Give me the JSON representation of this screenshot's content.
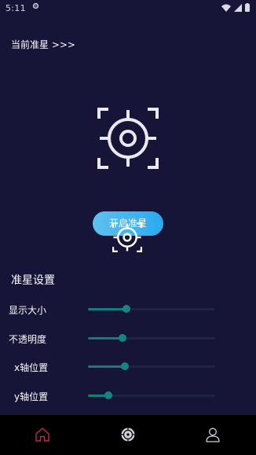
{
  "status_bar": {
    "time": "5:11",
    "left_icon": "settings-gear-icon",
    "right_icons": [
      "wifi-icon",
      "cellular-signal-icon",
      "battery-icon"
    ]
  },
  "header": {
    "current_crosshair_label": "当前准星 >>>"
  },
  "preview": {
    "icon": "crosshair-icon"
  },
  "start_button": {
    "label": "开启准星",
    "gradient": [
      "#5fc0ef",
      "#2aaaf0"
    ]
  },
  "settings": {
    "title": "准星设置",
    "sliders": [
      {
        "label": "显示大小",
        "value": 0.3
      },
      {
        "label": "不透明度",
        "value": 0.27
      },
      {
        "label": "x轴位置",
        "value": 0.29
      },
      {
        "label": "y轴位置",
        "value": 0.16
      }
    ]
  },
  "bottom_nav": {
    "items": [
      {
        "icon": "home-icon",
        "active": true
      },
      {
        "icon": "crosshair-settings-icon",
        "active": false
      },
      {
        "icon": "user-icon",
        "active": false
      }
    ]
  },
  "colors": {
    "background": "#171537",
    "slider_fill": "#137d78",
    "slider_track": "#1f2444",
    "nav_active": "#c9264a",
    "nav_inactive": "#cfcfd8"
  }
}
